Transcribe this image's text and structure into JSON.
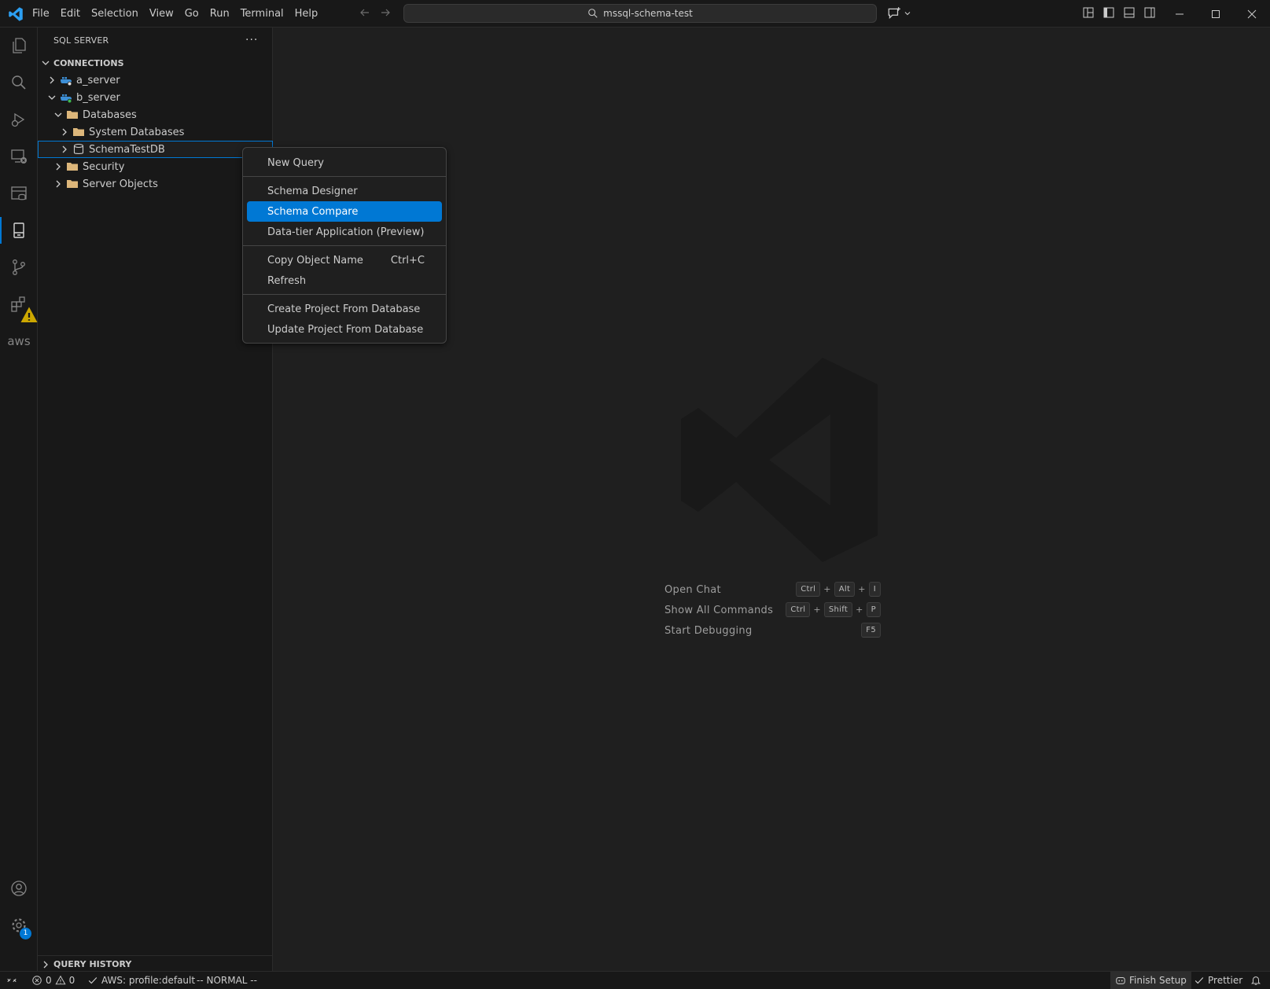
{
  "titlebar": {
    "menu": [
      "File",
      "Edit",
      "Selection",
      "View",
      "Go",
      "Run",
      "Terminal",
      "Help"
    ],
    "search_text": "mssql-schema-test"
  },
  "activity": {
    "extensions_badge": "warning",
    "settings_badge": "1",
    "aws_label": "aws"
  },
  "sidebar": {
    "title": "SQL SERVER",
    "more": "···",
    "connections_header": "CONNECTIONS",
    "tree": {
      "a_server": "a_server",
      "b_server": "b_server",
      "databases": "Databases",
      "system_databases": "System Databases",
      "schema_db": "SchemaTestDB",
      "security": "Security",
      "server_objects": "Server Objects"
    },
    "query_history": "QUERY HISTORY"
  },
  "context_menu": {
    "new_query": "New Query",
    "schema_designer": "Schema Designer",
    "schema_compare": "Schema Compare",
    "data_tier": "Data-tier Application (Preview)",
    "copy_object_name": "Copy Object Name",
    "copy_shortcut": "Ctrl+C",
    "refresh": "Refresh",
    "create_project": "Create Project From Database",
    "update_project": "Update Project From Database"
  },
  "editor_hints": {
    "open_chat": "Open Chat",
    "open_chat_keys": [
      "Ctrl",
      "Alt",
      "I"
    ],
    "show_commands": "Show All Commands",
    "show_commands_keys": [
      "Ctrl",
      "Shift",
      "P"
    ],
    "start_debugging": "Start Debugging",
    "start_debugging_key": "F5",
    "plus": "+"
  },
  "statusbar": {
    "errors": "0",
    "warnings": "0",
    "aws_profile": "AWS: profile:default",
    "vim_mode": "-- NORMAL --",
    "finish_setup": "Finish Setup",
    "prettier": "Prettier"
  },
  "colors": {
    "accent": "#0078d4",
    "background": "#1f1f1f",
    "chrome": "#181818",
    "folder": "#dcb67a",
    "warning": "#cca700"
  }
}
